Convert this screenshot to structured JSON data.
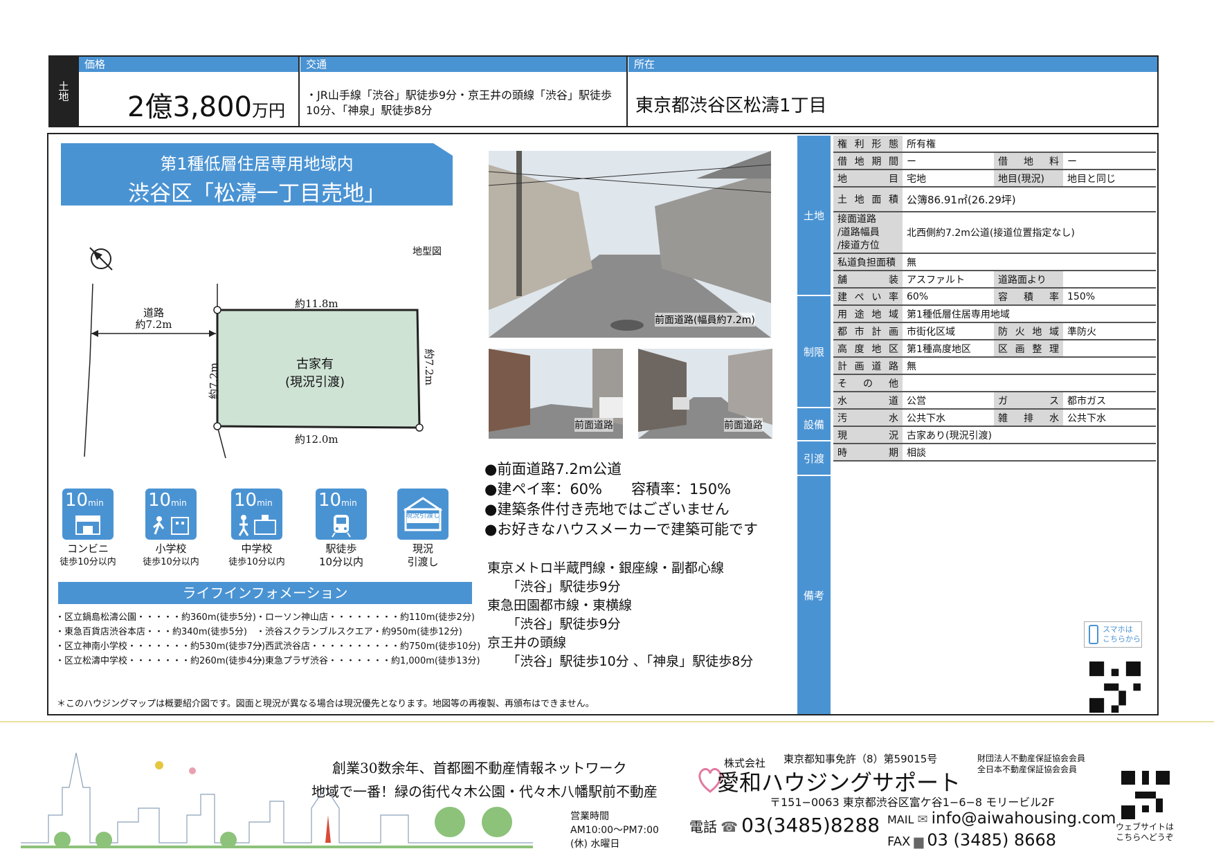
{
  "top": {
    "land_tab": "土地",
    "price_header": "価格",
    "price_oku": "2億",
    "price_num": "3,800",
    "price_unit": "万円",
    "access_header": "交通",
    "access_text": "・JR山手線「渋谷」駅徒歩9分・京王井の頭線「渋谷」駅徒歩10分、「神泉」駅徒歩8分",
    "location_header": "所在",
    "location_text": "東京都渋谷区松濤1丁目"
  },
  "banner": {
    "line1": "第1種低層住居専用地域内",
    "line2": "渋谷区「松濤一丁目売地」"
  },
  "map": {
    "label": "地型図",
    "road_label1": "道路",
    "road_label2": "約7.2m",
    "top_dim": "約11.8m",
    "bottom_dim": "約12.0m",
    "left_dim": "約7.2m",
    "right_dim": "約7.2m",
    "house1": "古家有",
    "house2": "(現況引渡)"
  },
  "icons": [
    {
      "min": "10",
      "unit": "min",
      "name": "コンビニ",
      "sub": "徒歩10分以内"
    },
    {
      "min": "10",
      "unit": "min",
      "name": "小学校",
      "sub": "徒歩10分以内"
    },
    {
      "min": "10",
      "unit": "min",
      "name": "中学校",
      "sub": "徒歩10分以内"
    },
    {
      "min": "10",
      "unit": "min",
      "name": "駅徒歩",
      "sub": "10分以内"
    },
    {
      "badge": "現況引渡し",
      "name": "現況",
      "sub": "引渡し"
    }
  ],
  "life": {
    "title": "ライフインフォメーション",
    "left": [
      "・区立鍋島松濤公園・・・・・約360m(徒歩5分)",
      "・東急百貨店渋谷本店・・・約340m(徒歩5分)",
      "・区立神南小学校・・・・・・・約530m(徒歩7分)",
      "・区立松濤中学校・・・・・・・約260m(徒歩4分)"
    ],
    "right": [
      "・ローソン神山店・・・・・・・・約110m(徒歩2分)",
      "・渋谷スクランブルスクエア・約950m(徒歩12分)",
      "・西武渋谷店・・・・・・・・・・約750m(徒歩10分)",
      "・東急プラザ渋谷・・・・・・・約1,000m(徒歩13分)"
    ]
  },
  "photos": {
    "main_caption": "前面道路(幅員約7.2m)",
    "small1_caption": "前面道路",
    "small2_caption": "前面道路"
  },
  "features": [
    "●前面道路7.2m公道",
    "●建ペイ率：60%　　容積率：150%",
    "●建築条件付き売地ではございません",
    "●お好きなハウスメーカーで建築可能です"
  ],
  "access_detail": [
    "東京メトロ半蔵門線・銀座線・副都心線",
    "　　「渋谷」駅徒歩9分",
    "東急田園都市線・東横線",
    "　　「渋谷」駅徒歩9分",
    "京王井の頭線",
    "　　「渋谷」駅徒歩10分 、「神泉」駅徒歩8分"
  ],
  "note": "＊このハウジングマップは概要紹介図です。図面と現況が異なる場合は現況優先となります。地図等の再複製、再頒布はできません。",
  "spec": {
    "groups": {
      "land": "土地",
      "restrict": "制限",
      "equip": "設備",
      "handover": "引渡",
      "remarks": "備考"
    },
    "rows": {
      "right_type_k": "権利形態",
      "right_type_v": "所有権",
      "lease_term_k": "借地期間",
      "lease_term_v": "ー",
      "lease_fee_k": "借地料",
      "lease_fee_v": "ー",
      "land_cat_k": "地目",
      "land_cat_v": "宅地",
      "land_cat_now_k": "地目(現況)",
      "land_cat_now_v": "地目と同じ",
      "area_k": "土地面積",
      "area_v": "公簿86.91㎡(26.29坪)",
      "road_k1": "接面道路",
      "road_k2": "/道路幅員",
      "road_k3": "/接道方位",
      "road_v": "北西側約7.2m公道(接道位置指定なし)",
      "private_road_k": "私道負担面積",
      "private_road_v": "無",
      "paving_k": "舗装",
      "paving_v": "アスファルト",
      "road_surface_k": "道路面より",
      "road_surface_v": "",
      "coverage_k": "建ぺい率",
      "coverage_v": "60%",
      "far_k": "容積率",
      "far_v": "150%",
      "zoning_k": "用途地域",
      "zoning_v": "第1種低層住居専用地域",
      "city_plan_k": "都市計画",
      "city_plan_v": "市街化区域",
      "fire_k": "防火地域",
      "fire_v": "準防火",
      "height_k": "高度地区",
      "height_v": "第1種高度地区",
      "readjust_k": "区画整理",
      "readjust_v": "",
      "plan_road_k": "計画道路",
      "plan_road_v": "無",
      "other_k": "その他",
      "other_v": "",
      "water_k": "水道",
      "water_v": "公営",
      "gas_k": "ガス",
      "gas_v": "都市ガス",
      "sewage_k": "汚水",
      "sewage_v": "公共下水",
      "drain_k": "雑排水",
      "drain_v": "公共下水",
      "status_k": "現況",
      "status_v": "古家あり(現況引渡)",
      "timing_k": "時期",
      "timing_v": "相談"
    }
  },
  "smartphone": {
    "line1": "スマホは",
    "line2": "こちらから"
  },
  "footer": {
    "slogan1": "創業30数余年、首都圏不動産情報ネットワーク",
    "slogan2": "地域で一番！緑の街代々木公園・代々木八幡駅前不動産",
    "hours_title": "営業時間",
    "hours": "AM10:00〜PM7:00",
    "holiday": "(休) 水曜日",
    "company_prefix": "株式会社",
    "company": "愛和ハウジングサポート",
    "license": "東京都知事免許（8）第59015号",
    "assoc1": "財団法人不動産保証協会会員",
    "assoc2": "全日本不動産保証協会会員",
    "address": "〒151−0063 東京都渋谷区富ケ谷1−6−8 モリービル2F",
    "tel_label": "電話",
    "tel": "03(3485)8288",
    "mail_label": "MAIL",
    "mail": "info@aiwahousing.com",
    "fax_label": "FAX",
    "fax": "03 (3485) 8668",
    "web1": "ウェブサイトは",
    "web2": "こちらへどうぞ"
  },
  "colors": {
    "accent": "#4a93d3",
    "lot": "#cfe3d5",
    "dark": "#222222"
  }
}
